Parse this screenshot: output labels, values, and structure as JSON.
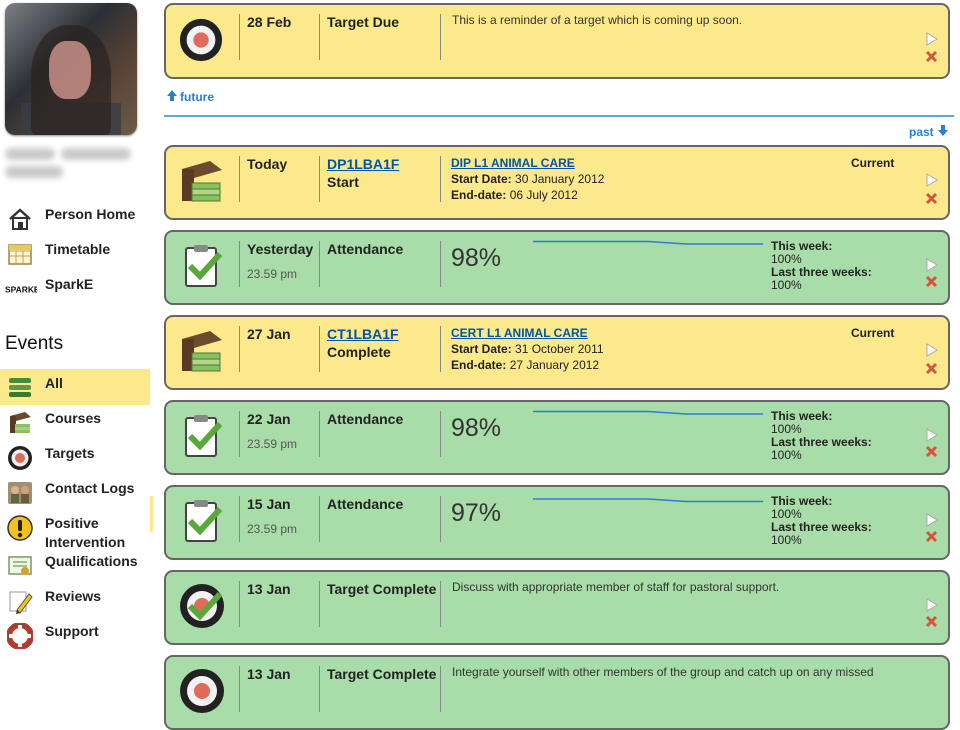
{
  "sidebar": {
    "nav": [
      {
        "label": "Person Home",
        "icon": "house-icon"
      },
      {
        "label": "Timetable",
        "icon": "calendar-icon"
      },
      {
        "label": "SparkE",
        "icon": "sparke-logo-icon",
        "logo_text": "SPARKE"
      }
    ],
    "events_heading": "Events",
    "events": [
      {
        "label": "All",
        "icon": "all-events-icon",
        "active": true
      },
      {
        "label": "Courses",
        "icon": "books-icon"
      },
      {
        "label": "Targets",
        "icon": "target-icon"
      },
      {
        "label": "Contact Logs",
        "icon": "contact-logs-icon"
      },
      {
        "label": "Positive\nIntervention",
        "icon": "exclamation-icon"
      },
      {
        "label": "Qualifications",
        "icon": "certificate-icon"
      },
      {
        "label": "Reviews",
        "icon": "pencil-icon"
      },
      {
        "label": "Support",
        "icon": "lifebuoy-icon"
      }
    ]
  },
  "nav_links": {
    "future": "future",
    "past": "past"
  },
  "colors": {
    "yellow_card": "#fbe98c",
    "green_card": "#a8dca8",
    "link": "#2a7fd4",
    "divider": "#5aaade"
  },
  "cards": [
    {
      "kind": "target",
      "color": "yellow",
      "date": "28 Feb",
      "type": "Target Due",
      "description": "This is a reminder of a target which is coming up soon."
    },
    {
      "kind": "course",
      "color": "yellow",
      "date": "Today",
      "code": "DP1LBA1F",
      "status": "Start",
      "course_name": "DIP L1 ANIMAL CARE",
      "start_label": "Start Date:",
      "start_date": "30 January 2012",
      "end_label": "End-date:",
      "end_date": "06 July 2012",
      "current": "Current"
    },
    {
      "kind": "attendance",
      "color": "green",
      "date": "Yesterday",
      "time": "23.59 pm",
      "type": "Attendance",
      "percent": "98%",
      "week_label": "This week:",
      "week_value": "100%",
      "three_label": "Last three weeks:",
      "three_value": "100%",
      "trend": [
        99,
        99,
        99,
        99,
        98,
        98,
        98
      ]
    },
    {
      "kind": "course",
      "color": "yellow",
      "date": "27 Jan",
      "code": "CT1LBA1F",
      "status": "Complete",
      "course_name": "CERT L1 ANIMAL CARE",
      "start_label": "Start Date:",
      "start_date": "31 October 2011",
      "end_label": "End-date:",
      "end_date": "27 January 2012",
      "current": "Current"
    },
    {
      "kind": "attendance",
      "color": "green",
      "date": "22 Jan",
      "time": "23.59 pm",
      "type": "Attendance",
      "percent": "98%",
      "week_label": "This week:",
      "week_value": "100%",
      "three_label": "Last three weeks:",
      "three_value": "100%",
      "trend": [
        99,
        99,
        99,
        99,
        98,
        98,
        98
      ]
    },
    {
      "kind": "attendance",
      "color": "green",
      "date": "15 Jan",
      "time": "23.59 pm",
      "type": "Attendance",
      "percent": "97%",
      "week_label": "This week:",
      "week_value": "100%",
      "three_label": "Last three weeks:",
      "three_value": "100%",
      "trend": [
        98,
        98,
        98,
        98,
        97,
        97,
        97
      ]
    },
    {
      "kind": "target_complete",
      "color": "green",
      "date": "13 Jan",
      "type": "Target Complete",
      "description": "Discuss with appropriate member of staff for pastoral support."
    },
    {
      "kind": "target_complete",
      "color": "green",
      "date": "13 Jan",
      "type": "Target Complete",
      "description": "Integrate yourself with other members of the group and catch up on any missed"
    }
  ]
}
